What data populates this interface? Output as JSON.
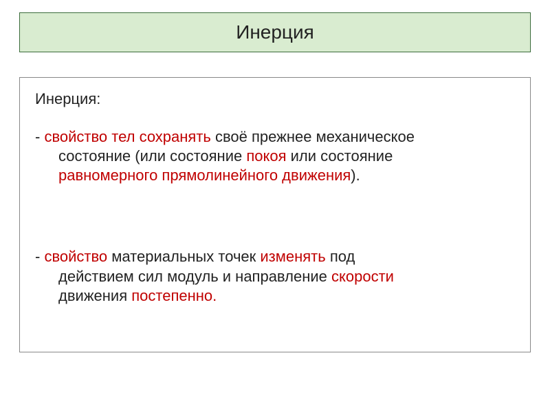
{
  "title": "Инерция",
  "body": {
    "heading": "Инерция:",
    "def1": {
      "lead": "- ",
      "r1": "свойство тел сохранять",
      "k1": " своё прежнее механическое ",
      "cont1a": "состояние (или состояние ",
      "r2": "покоя",
      "k2": " или состояние ",
      "cont2a": "равномерного прямолинейного движения",
      "k3": ")."
    },
    "def2": {
      "lead": " - ",
      "r1": "свойство",
      "k1": " материальных точек ",
      "r2": "изменять",
      "k2": " под ",
      "cont1a": "действием сил модуль и направление ",
      "r3": "скорости",
      "cont2a": "движения ",
      "r4": "постепенно."
    }
  }
}
